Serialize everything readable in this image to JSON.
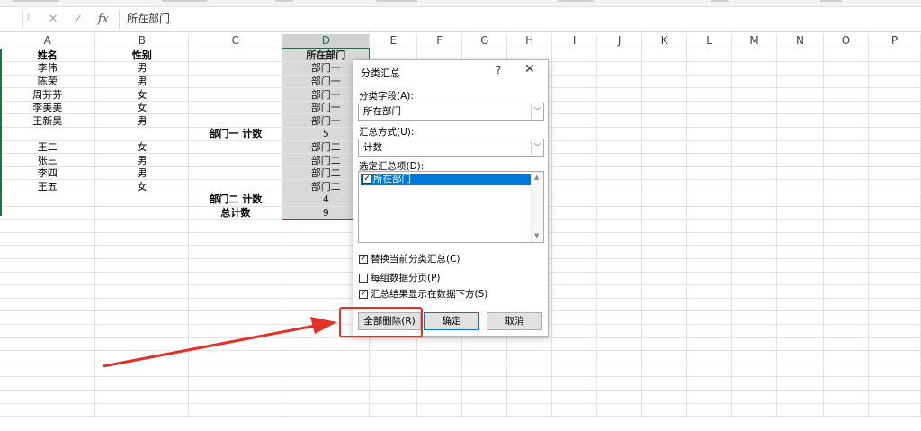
{
  "formula_bar": {
    "cancel_icon": "close-icon",
    "enter_icon": "check-icon",
    "fx_label": "fx",
    "content": "所在部门"
  },
  "columns": [
    "A",
    "B",
    "C",
    "D",
    "E",
    "F",
    "G",
    "H",
    "I",
    "J",
    "K",
    "L",
    "M",
    "N",
    "O",
    "P"
  ],
  "rows": [
    {
      "a": "姓名",
      "b": "性别",
      "c": "",
      "d": "所在部门",
      "head": true
    },
    {
      "a": "李伟",
      "b": "男",
      "c": "",
      "d": "部门一"
    },
    {
      "a": "陈荣",
      "b": "男",
      "c": "",
      "d": "部门一"
    },
    {
      "a": "周芬芬",
      "b": "女",
      "c": "",
      "d": "部门一"
    },
    {
      "a": "李美美",
      "b": "女",
      "c": "",
      "d": "部门一"
    },
    {
      "a": "王新昊",
      "b": "男",
      "c": "",
      "d": "部门一"
    },
    {
      "a": "",
      "b": "",
      "c": "部门一 计数",
      "d": "5",
      "subtotal": true
    },
    {
      "a": "王二",
      "b": "女",
      "c": "",
      "d": "部门二"
    },
    {
      "a": "张三",
      "b": "男",
      "c": "",
      "d": "部门二"
    },
    {
      "a": "李四",
      "b": "男",
      "c": "",
      "d": "部门二"
    },
    {
      "a": "王五",
      "b": "女",
      "c": "",
      "d": "部门二"
    },
    {
      "a": "",
      "b": "",
      "c": "部门二 计数",
      "d": "4",
      "subtotal": true
    },
    {
      "a": "",
      "b": "",
      "c": "总计数",
      "d": "9",
      "subtotal": true
    }
  ],
  "dialog": {
    "title": "分类汇总",
    "help": "?",
    "close": "✕",
    "group_by_label": "分类字段(A):",
    "group_by_value": "所在部门",
    "function_label": "汇总方式(U):",
    "function_value": "计数",
    "add_to_label": "选定汇总项(D):",
    "add_to_items": [
      {
        "label": "所在部门",
        "checked": true
      }
    ],
    "options": [
      {
        "label": "替换当前分类汇总(C)",
        "checked": true
      },
      {
        "label": "每组数据分页(P)",
        "checked": false
      },
      {
        "label": "汇总结果显示在数据下方(S)",
        "checked": true
      }
    ],
    "remove_all": "全部删除(R)",
    "ok": "确定",
    "cancel": "取消"
  },
  "colors": {
    "selection_green": "#217346",
    "annotation_red": "#e53125",
    "list_highlight": "#0078d7"
  }
}
